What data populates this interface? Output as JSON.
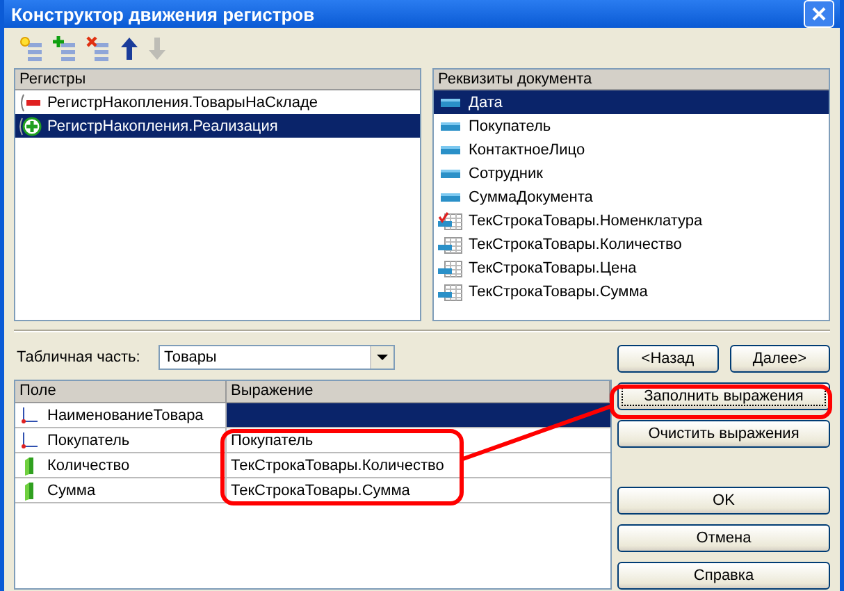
{
  "window": {
    "title": "Конструктор движения регистров"
  },
  "toolbar": [
    {
      "kind": "new",
      "disabled": false
    },
    {
      "kind": "add",
      "disabled": false
    },
    {
      "kind": "delete",
      "disabled": false
    },
    {
      "kind": "up",
      "disabled": false
    },
    {
      "kind": "down",
      "disabled": true
    }
  ],
  "registers": {
    "header": "Регистры",
    "items": [
      {
        "label": "РегистрНакопления.ТоварыНаСкладе",
        "kind": "expense",
        "selected": false
      },
      {
        "label": "РегистрНакопления.Реализация",
        "kind": "receipt",
        "selected": true
      }
    ]
  },
  "attributes": {
    "header": "Реквизиты документа",
    "items": [
      {
        "label": "Дата",
        "kind": "field",
        "selected": true
      },
      {
        "label": "Покупатель",
        "kind": "field",
        "selected": false
      },
      {
        "label": "КонтактноеЛицо",
        "kind": "field",
        "selected": false
      },
      {
        "label": "Сотрудник",
        "kind": "field",
        "selected": false
      },
      {
        "label": "СуммаДокумента",
        "kind": "field",
        "selected": false
      },
      {
        "label": "ТекСтрокаТовары.Номенклатура",
        "kind": "marked_column",
        "selected": false
      },
      {
        "label": "ТекСтрокаТовары.Количество",
        "kind": "column",
        "selected": false
      },
      {
        "label": "ТекСтрокаТовары.Цена",
        "kind": "column",
        "selected": false
      },
      {
        "label": "ТекСтрокаТовары.Сумма",
        "kind": "column",
        "selected": false
      }
    ]
  },
  "tabular_part": {
    "label": "Табличная часть:",
    "value": "Товары"
  },
  "grid": {
    "columns": [
      "Поле",
      "Выражение"
    ],
    "rows": [
      {
        "field": "НаименованиеТовара",
        "kind": "dimension",
        "expression": "",
        "selected": true
      },
      {
        "field": "Покупатель",
        "kind": "dimension",
        "expression": "Покупатель",
        "selected": false
      },
      {
        "field": "Количество",
        "kind": "resource",
        "expression": "ТекСтрокаТовары.Количество",
        "selected": false
      },
      {
        "field": "Сумма",
        "kind": "resource",
        "expression": "ТекСтрокаТовары.Сумма",
        "selected": false
      }
    ]
  },
  "nav_buttons": [
    "<Назад",
    "Далее>"
  ],
  "expression_buttons": [
    {
      "label": "Заполнить выражения",
      "focused": true
    },
    {
      "label": "Очистить выражения",
      "focused": false
    }
  ],
  "dialog_buttons": [
    "OK",
    "Отмена",
    "Справка"
  ]
}
